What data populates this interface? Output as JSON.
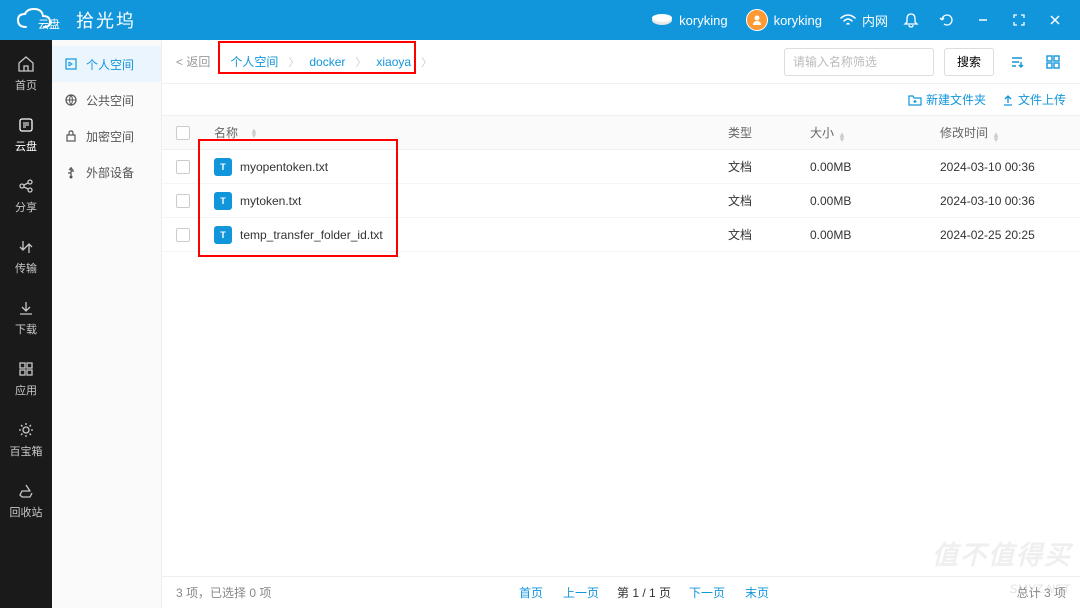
{
  "titlebar": {
    "logo_sub": "云盘",
    "logo_main": "拾光坞",
    "device": "koryking",
    "user": "koryking",
    "network": "内网"
  },
  "rail": {
    "items": [
      {
        "label": "首页",
        "icon": "home"
      },
      {
        "label": "云盘",
        "icon": "cloud"
      },
      {
        "label": "分享",
        "icon": "share"
      },
      {
        "label": "传输",
        "icon": "transfer"
      },
      {
        "label": "下载",
        "icon": "download"
      },
      {
        "label": "应用",
        "icon": "apps"
      },
      {
        "label": "百宝箱",
        "icon": "toolbox"
      },
      {
        "label": "回收站",
        "icon": "recycle"
      }
    ]
  },
  "sidebar": {
    "items": [
      {
        "label": "个人空间",
        "icon": "personal"
      },
      {
        "label": "公共空间",
        "icon": "public"
      },
      {
        "label": "加密空间",
        "icon": "lock"
      },
      {
        "label": "外部设备",
        "icon": "usb"
      }
    ]
  },
  "toolbar": {
    "back": "< 返回",
    "crumbs": [
      "个人空间",
      "docker",
      "xiaoya"
    ],
    "search_placeholder": "请输入名称筛选",
    "search_btn": "搜索"
  },
  "actions": {
    "new_folder": "新建文件夹",
    "upload": "文件上传"
  },
  "table": {
    "headers": {
      "name": "名称",
      "type": "类型",
      "size": "大小",
      "time": "修改时间"
    },
    "rows": [
      {
        "name": "myopentoken.txt",
        "type": "文档",
        "size": "0.00MB",
        "time": "2024-03-10 00:36"
      },
      {
        "name": "mytoken.txt",
        "type": "文档",
        "size": "0.00MB",
        "time": "2024-03-10 00:36"
      },
      {
        "name": "temp_transfer_folder_id.txt",
        "type": "文档",
        "size": "0.00MB",
        "time": "2024-02-25 20:25"
      }
    ]
  },
  "footer": {
    "status": "3 项，已选择 0 项",
    "first": "首页",
    "prev": "上一页",
    "page": "第 1 / 1 页",
    "next": "下一页",
    "last": "末页",
    "total": "总计 3 项"
  },
  "watermark1": "值不值得买",
  "watermark2": "SMYZ.NET"
}
